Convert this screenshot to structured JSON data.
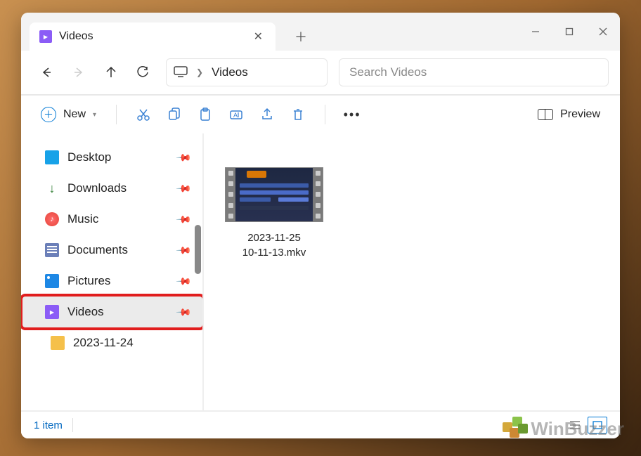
{
  "tab": {
    "title": "Videos"
  },
  "breadcrumb": {
    "label": "Videos"
  },
  "search": {
    "placeholder": "Search Videos"
  },
  "toolbar": {
    "new_label": "New",
    "preview_label": "Preview"
  },
  "sidebar": {
    "items": [
      {
        "label": "Desktop"
      },
      {
        "label": "Downloads"
      },
      {
        "label": "Music"
      },
      {
        "label": "Documents"
      },
      {
        "label": "Pictures"
      },
      {
        "label": "Videos"
      },
      {
        "label": "2023-11-24"
      }
    ]
  },
  "files": [
    {
      "name_line1": "2023-11-25",
      "name_line2": "10-11-13.mkv"
    }
  ],
  "status": {
    "count": "1 item"
  },
  "watermark": {
    "text": "WinBuzzer"
  }
}
